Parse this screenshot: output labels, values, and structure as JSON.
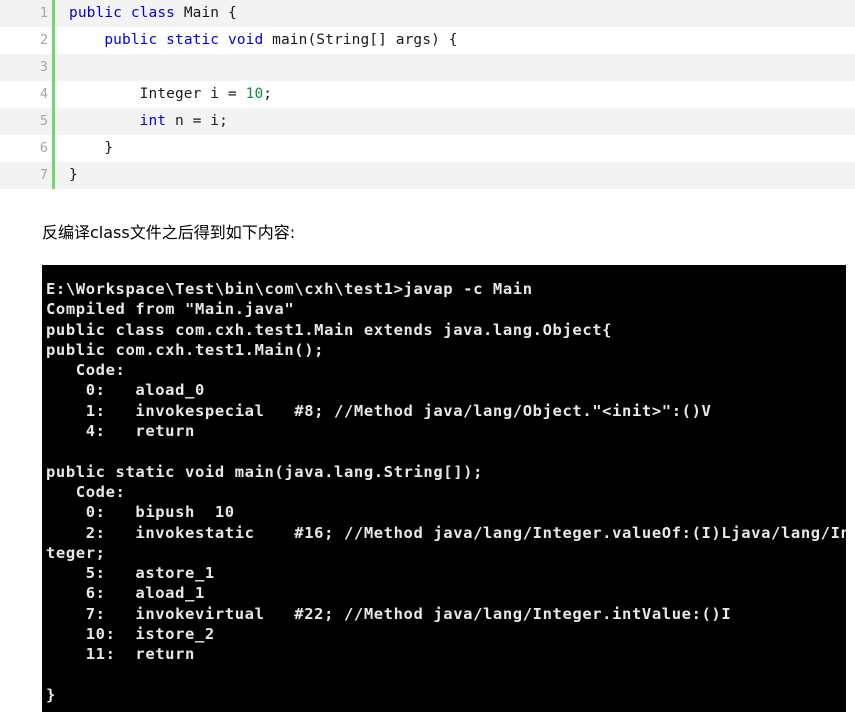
{
  "code_block": {
    "language": "java",
    "gutter_accent_color": "#6fd96f",
    "stripe_color": "#f3f3f3",
    "keyword_color": "#0000e6",
    "number_color": "#0a8f36",
    "lines": [
      {
        "number": "1",
        "tokens": [
          {
            "t": "public",
            "c": "kw"
          },
          {
            "t": " ",
            "c": "pl"
          },
          {
            "t": "class",
            "c": "kw"
          },
          {
            "t": " Main {",
            "c": "pl"
          }
        ]
      },
      {
        "number": "2",
        "tokens": [
          {
            "t": "    ",
            "c": "pl"
          },
          {
            "t": "public",
            "c": "kw"
          },
          {
            "t": " ",
            "c": "pl"
          },
          {
            "t": "static",
            "c": "kw"
          },
          {
            "t": " ",
            "c": "pl"
          },
          {
            "t": "void",
            "c": "kw"
          },
          {
            "t": " main(String[] args) {",
            "c": "pl"
          }
        ]
      },
      {
        "number": "3",
        "tokens": [
          {
            "t": "",
            "c": "pl"
          }
        ]
      },
      {
        "number": "4",
        "tokens": [
          {
            "t": "        Integer i = ",
            "c": "pl"
          },
          {
            "t": "10",
            "c": "num"
          },
          {
            "t": ";",
            "c": "pl"
          }
        ]
      },
      {
        "number": "5",
        "tokens": [
          {
            "t": "        ",
            "c": "pl"
          },
          {
            "t": "int",
            "c": "kw"
          },
          {
            "t": " n = i;",
            "c": "pl"
          }
        ]
      },
      {
        "number": "6",
        "tokens": [
          {
            "t": "    }",
            "c": "pl"
          }
        ]
      },
      {
        "number": "7",
        "tokens": [
          {
            "t": "}",
            "c": "pl"
          }
        ]
      }
    ]
  },
  "caption": {
    "text": "反编译class文件之后得到如下内容:"
  },
  "console": {
    "background_color": "#000000",
    "text_color": "#e8e8e8",
    "prompt_path": "E:\\Workspace\\Test\\bin\\com\\cxh\\test1>",
    "command": "javap -c Main",
    "lines": [
      "E:\\Workspace\\Test\\bin\\com\\cxh\\test1>javap -c Main",
      "Compiled from \"Main.java\"",
      "public class com.cxh.test1.Main extends java.lang.Object{",
      "public com.cxh.test1.Main();",
      "  Code:",
      "   0:\taload_0",
      "   1:\tinvokespecial\t#8; //Method java/lang/Object.\"<init>\":()V",
      "   4:\treturn",
      "",
      "public static void main(java.lang.String[]);",
      "  Code:",
      "   0:\tbipush\t10",
      "   2:\tinvokestatic\t#16; //Method java/lang/Integer.valueOf:(I)Ljava/lang/In",
      "teger;",
      "   5:\tastore_1",
      "   6:\taload_1",
      "   7:\tinvokevirtual\t#22; //Method java/lang/Integer.intValue:()I",
      "   10:\tistore_2",
      "   11:\treturn",
      "",
      "}"
    ],
    "rendered_lines": [
      "E:\\Workspace\\Test\\bin\\com\\cxh\\test1>javap -c Main",
      "Compiled from \"Main.java\"",
      "public class com.cxh.test1.Main extends java.lang.Object{",
      "public com.cxh.test1.Main();",
      "   Code:",
      "    0:   aload_0",
      "    1:   invokespecial   #8; //Method java/lang/Object.\"<init>\":()V",
      "    4:   return",
      "",
      "public static void main(java.lang.String[]);",
      "   Code:",
      "    0:   bipush  10",
      "    2:   invokestatic    #16; //Method java/lang/Integer.valueOf:(I)Ljava/lang/In",
      "teger;",
      "    5:   astore_1",
      "    6:   aload_1",
      "    7:   invokevirtual   #22; //Method java/lang/Integer.intValue:()I",
      "    10:  istore_2",
      "    11:  return",
      "",
      "}"
    ]
  }
}
